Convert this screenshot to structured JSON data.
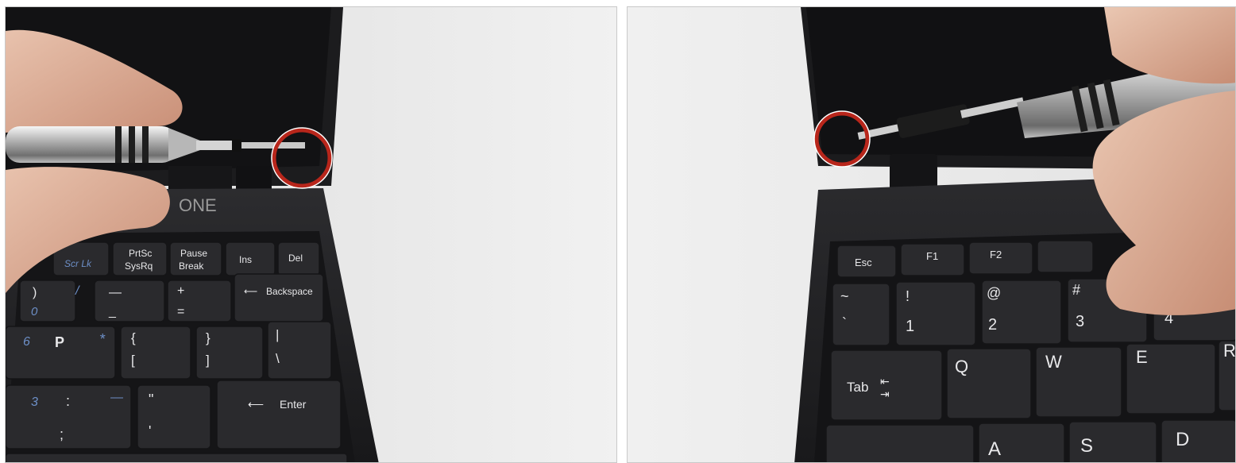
{
  "photo_left": {
    "brand_partial": "ONE",
    "key_labels": {
      "scrlk": "Scr Lk",
      "prtsc": "PrtSc",
      "sysrq": "SysRq",
      "pause": "Pause",
      "break": "Break",
      "ins": "Ins",
      "del": "Del",
      "backspace": "Backspace",
      "enter": "Enter",
      "zero": "0",
      "close_paren": ")",
      "slash": "/",
      "minus": "—",
      "underscore": "_",
      "plus": "+",
      "equals": "=",
      "six": "6",
      "p": "P",
      "star": "*",
      "lbrace": "{",
      "lbracket": "[",
      "rbrace": "}",
      "rbracket": "]",
      "pipe": "|",
      "backslash": "\\",
      "three": "3",
      "colon": ":",
      "semicolon": ";",
      "dash_blue": "—",
      "quote": "\"",
      "apostrophe": "'"
    }
  },
  "photo_right": {
    "key_labels": {
      "esc": "Esc",
      "f1": "F1",
      "f2": "F2",
      "tilde": "~",
      "backtick": "`",
      "exclaim": "!",
      "one": "1",
      "at": "@",
      "two": "2",
      "hash": "#",
      "three": "3",
      "four": "4",
      "tab": "Tab",
      "q": "Q",
      "w": "W",
      "e": "E",
      "r": "R",
      "a": "A",
      "s": "S",
      "d": "D"
    }
  },
  "colors": {
    "highlight_ring": "#b8261b",
    "keyboard": "#2a2a2d",
    "background": "#f3f3f3"
  }
}
